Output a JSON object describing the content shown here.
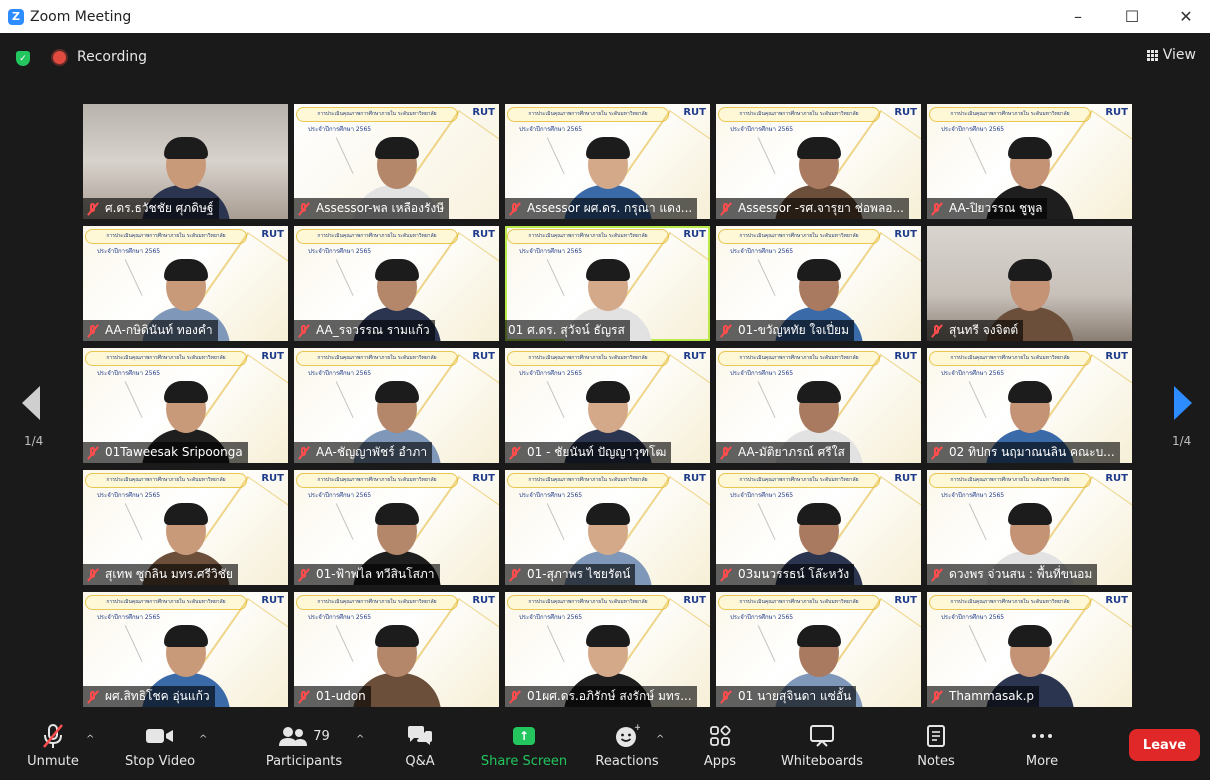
{
  "window": {
    "title": "Zoom Meeting",
    "app_logo": "Z",
    "controls": [
      "–",
      "☐",
      "✕"
    ]
  },
  "meeting": {
    "recording_label": "Recording",
    "view_label": "View",
    "security_badge": "✓"
  },
  "pagination": {
    "left": "1/4",
    "right": "1/4"
  },
  "tile_text": {
    "banner": "การประเมินคุณภาพการศึกษาภายใน ระดับมหาวิทยาลัย",
    "year": "ประจำปีการศึกษา 2565",
    "logo": "RUT"
  },
  "participants": [
    {
      "name": "ศ.ดร.ธวัชชัย ศุภดิษฐ์",
      "muted": true
    },
    {
      "name": "Assessor-พล เหลืองรังษี",
      "muted": true
    },
    {
      "name": "Assessor ผศ.ดร. กรุณา แดง...",
      "muted": true
    },
    {
      "name": "Assessor -รศ.จารุยา ช่อพลอ...",
      "muted": true
    },
    {
      "name": "AA-ปิยวรรณ ชูพูล",
      "muted": true
    },
    {
      "name": "AA-กษิดินันท์ ทองคำ",
      "muted": true
    },
    {
      "name": "AA_รจวรรณ รามแก้ว",
      "muted": true
    },
    {
      "name": "01 ศ.ดร. สุวัจน์ ธัญรส",
      "muted": false
    },
    {
      "name": "01-ขวัญหทัย ใจเปี่ยม",
      "muted": true
    },
    {
      "name": "สุนทรี จงจิตต์",
      "muted": true
    },
    {
      "name": "01Taweesak Sripoonga",
      "muted": true
    },
    {
      "name": "AA-ชัญญาพัชร์ อำภา",
      "muted": true
    },
    {
      "name": "01 - ชัยนันท์ ปัญญาวุฑโฒ",
      "muted": true
    },
    {
      "name": "AA-มัติยาภรณ์ ศรีใส",
      "muted": true
    },
    {
      "name": "02 ทิปกร นฤมาณนลิน คณะบ...",
      "muted": true
    },
    {
      "name": "สุเทพ ซูกลิน มทร.ศรีวิชัย",
      "muted": true
    },
    {
      "name": "01-ฟ้าพไล ทวีสินโสภา",
      "muted": true
    },
    {
      "name": "01-สุภาพร ไชยรัตน์",
      "muted": true
    },
    {
      "name": "03มนวรรธน์ โล๊ะหวัง",
      "muted": true
    },
    {
      "name": "ดวงพร จ่วนสน : พื้นที่ขนอม",
      "muted": true
    },
    {
      "name": "ผศ.สิทธิโชค อุ่นแก้ว",
      "muted": true
    },
    {
      "name": "01-udon",
      "muted": true
    },
    {
      "name": "01ผศ.ดร.อภิรักษ์ สงรักษ์ มทร...",
      "muted": true
    },
    {
      "name": "01 นายสุจินดา แซ่อั้น",
      "muted": true
    },
    {
      "name": "Thammasak.p",
      "muted": true
    }
  ],
  "toolbar": {
    "unmute": "Unmute",
    "stop_video": "Stop Video",
    "participants": "Participants",
    "participants_count": "79",
    "qa": "Q&A",
    "share_screen": "Share Screen",
    "reactions": "Reactions",
    "apps": "Apps",
    "whiteboards": "Whiteboards",
    "notes": "Notes",
    "more": "More",
    "leave": "Leave"
  },
  "colors": {
    "accent": "#2D8CFF",
    "share_green": "#22C55E",
    "leave_red": "#E02828",
    "muted_red": "#FF4D4D",
    "speaking": "#B9E94A"
  }
}
